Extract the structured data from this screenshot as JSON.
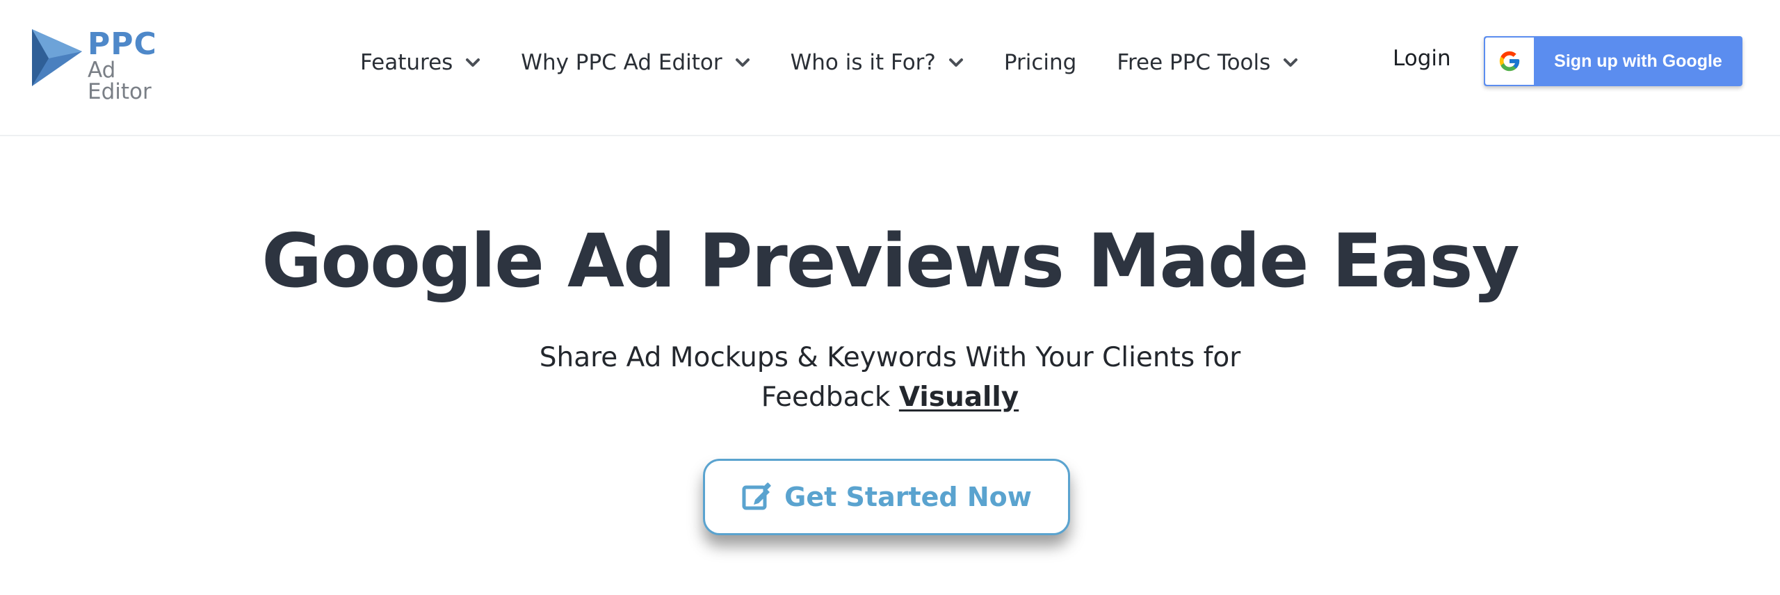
{
  "header": {
    "logo": {
      "primary": "PPC",
      "secondary": "Ad Editor"
    },
    "nav": [
      {
        "label": "Features",
        "has_dropdown": true
      },
      {
        "label": "Why PPC Ad Editor",
        "has_dropdown": true
      },
      {
        "label": "Who is it For?",
        "has_dropdown": true
      },
      {
        "label": "Pricing",
        "has_dropdown": false
      },
      {
        "label": "Free PPC Tools",
        "has_dropdown": true
      }
    ],
    "login_label": "Login",
    "signup_google_label": "Sign up with Google"
  },
  "hero": {
    "title": "Google Ad Previews Made Easy",
    "subtitle_line1": "Share Ad Mockups & Keywords With Your Clients for",
    "subtitle_line2_prefix": "Feedback ",
    "subtitle_emphasis": "Visually",
    "cta_label": "Get Started Now"
  },
  "icons": {
    "logo": "ppc-triangle-logo-icon",
    "dropdown": "chevron-down-icon",
    "google": "google-g-icon",
    "cta": "edit-pencil-icon"
  },
  "colors": {
    "brand_blue": "#4e88c9",
    "google_button": "#5b8def",
    "cta_accent": "#5aa3cf",
    "heading": "#2d3440"
  }
}
